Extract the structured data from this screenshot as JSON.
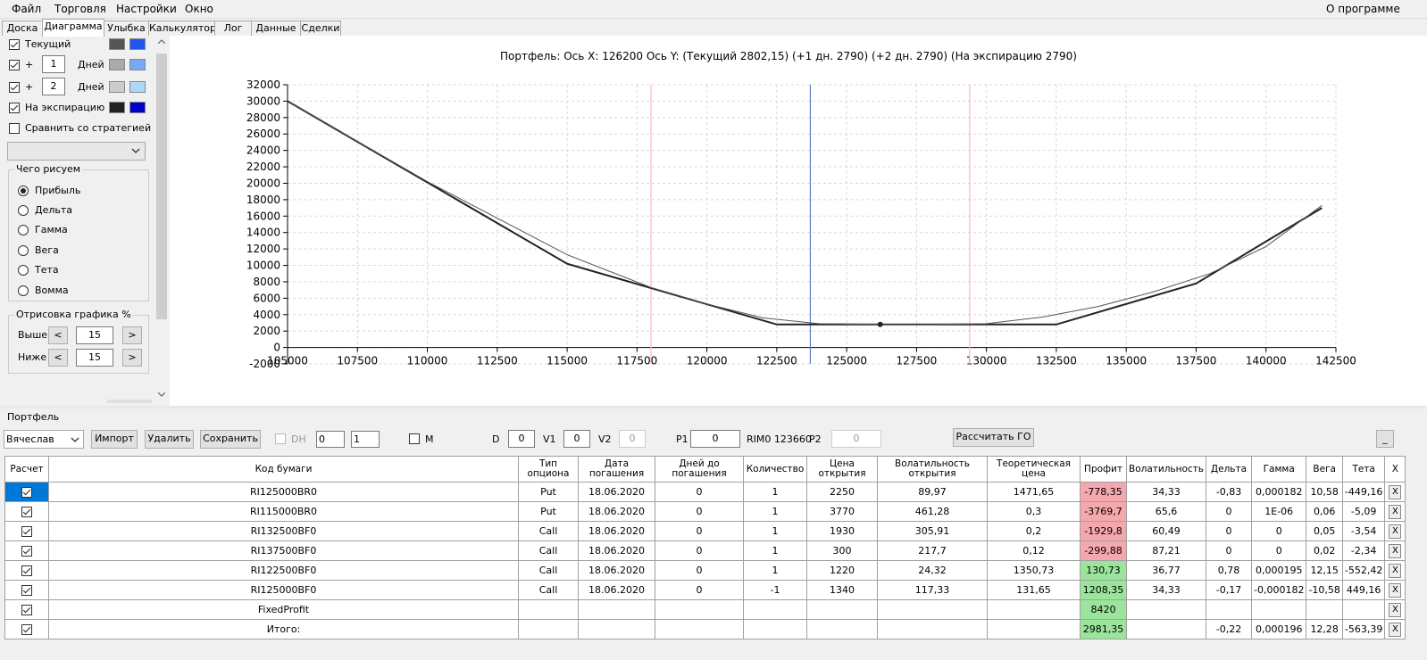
{
  "menu": {
    "file": "Файл",
    "trade": "Торговля",
    "settings": "Настройки",
    "window": "Окно",
    "about": "О программе"
  },
  "tabs": [
    "Доска",
    "Диаграмма",
    "Улыбка",
    "Калькулятор",
    "Лог",
    "Данные",
    "Сделки"
  ],
  "left": {
    "current": "Текущий",
    "plus1": "+",
    "days1": "1",
    "days_label1": "Дней",
    "plus2": "+",
    "days2": "2",
    "days_label2": "Дней",
    "expiration": "На экспирацию",
    "compare": "Сравнить со стратегией",
    "what_group": "Чего рисуем",
    "radios": [
      "Прибыль",
      "Дельта",
      "Гамма",
      "Вега",
      "Тета",
      "Вомма"
    ],
    "draw_group": "Отрисовка графика %",
    "above": "Выше",
    "above_val": "15",
    "below": "Ниже",
    "below_val": "15",
    "lt": "<",
    "gt": ">",
    "colors": {
      "current_dark": "#555555",
      "current_light": "#2255ee",
      "d1_dark": "#aaaaaa",
      "d1_light": "#77aaf5",
      "d2_dark": "#cccccc",
      "d2_light": "#aad8f5",
      "exp_dark": "#222222",
      "exp_light": "#0000cc"
    }
  },
  "chart_data": {
    "type": "line",
    "title": "Портфель: Ось X:  126200 Ось Y:  (Текущий 2802,15)  (+1 дн. 2790)  (+2 дн. 2790)  (На экспирацию 2790)",
    "xlim": [
      105000,
      142500
    ],
    "ylim": [
      -2000,
      32000
    ],
    "x_ticks": [
      "105000",
      "107500",
      "110000",
      "112500",
      "115000",
      "117500",
      "120000",
      "122500",
      "125000",
      "127500",
      "130000",
      "132500",
      "135000",
      "137500",
      "140000",
      "142500"
    ],
    "y_ticks": [
      "32000",
      "30000",
      "28000",
      "26000",
      "24000",
      "22000",
      "20000",
      "18000",
      "16000",
      "14000",
      "12000",
      "10000",
      "8000",
      "6000",
      "4000",
      "2000",
      "0",
      "-2000"
    ],
    "series": [
      {
        "values_x": [
          105000,
          115000,
          122500,
          132500,
          137500,
          142000
        ],
        "values_y": [
          30000,
          10200,
          2800,
          2800,
          7800,
          17000
        ],
        "color": "#222222"
      },
      {
        "values_x": [
          105000,
          110000,
          115000,
          118000,
          120000,
          122000,
          124000,
          126200,
          128000,
          130000,
          132000,
          134000,
          136000,
          138000,
          140000,
          142000
        ],
        "values_y": [
          30000,
          20200,
          11300,
          7300,
          5300,
          3600,
          2900,
          2802,
          2790,
          2900,
          3700,
          5000,
          6800,
          9000,
          12300,
          17300
        ],
        "color": "#555555"
      }
    ],
    "marker": {
      "x": 126200,
      "y": 2802
    },
    "vlines": [
      {
        "x": 118000,
        "color": "#ffb6c1"
      },
      {
        "x": 123700,
        "color": "#5b7fbf"
      },
      {
        "x": 129400,
        "color": "#ffb6c1"
      }
    ]
  },
  "portfolio": {
    "label": "Портфель",
    "account": "Вячеслав",
    "import": "Импорт",
    "delete": "Удалить",
    "save": "Сохранить",
    "dh": "DH",
    "dh_v1": "0",
    "dh_v2": "1",
    "m": "M",
    "d": "D",
    "d_val": "0",
    "v1": "V1",
    "v1_val": "0",
    "v2": "V2",
    "v2_val": "0",
    "p1": "P1",
    "p1_val": "0",
    "rim": "RIM0 123660",
    "p2": "P2",
    "p2_val": "0",
    "calc": "Рассчитать ГО",
    "minimize": "_"
  },
  "table": {
    "headers": [
      "Расчет",
      "Код бумаги",
      "Тип опциона",
      "Дата погашения",
      "Дней до погашения",
      "Количество",
      "Цена открытия",
      "Волатильность открытия",
      "Теоретическая цена",
      "Профит",
      "Волатильность",
      "Дельта",
      "Гамма",
      "Вега",
      "Тета",
      "X"
    ],
    "rows": [
      {
        "code": "RI125000BR0",
        "type": "Put",
        "date": "18.06.2020",
        "days": "0",
        "qty": "1",
        "price": "2250",
        "vol_open": "89,97",
        "theo": "1471,65",
        "profit": "-778,35",
        "vol": "34,33",
        "delta": "-0,83",
        "gamma": "0,000182",
        "vega": "10,58",
        "theta": "-449,16",
        "x": "X",
        "neg": true
      },
      {
        "code": "RI115000BR0",
        "type": "Put",
        "date": "18.06.2020",
        "days": "0",
        "qty": "1",
        "price": "3770",
        "vol_open": "461,28",
        "theo": "0,3",
        "profit": "-3769,7",
        "vol": "65,6",
        "delta": "0",
        "gamma": "1E-06",
        "vega": "0,06",
        "theta": "-5,09",
        "x": "X",
        "neg": true
      },
      {
        "code": "RI132500BF0",
        "type": "Call",
        "date": "18.06.2020",
        "days": "0",
        "qty": "1",
        "price": "1930",
        "vol_open": "305,91",
        "theo": "0,2",
        "profit": "-1929,8",
        "vol": "60,49",
        "delta": "0",
        "gamma": "0",
        "vega": "0,05",
        "theta": "-3,54",
        "x": "X",
        "neg": true
      },
      {
        "code": "RI137500BF0",
        "type": "Call",
        "date": "18.06.2020",
        "days": "0",
        "qty": "1",
        "price": "300",
        "vol_open": "217,7",
        "theo": "0,12",
        "profit": "-299,88",
        "vol": "87,21",
        "delta": "0",
        "gamma": "0",
        "vega": "0,02",
        "theta": "-2,34",
        "x": "X",
        "neg": true
      },
      {
        "code": "RI122500BF0",
        "type": "Call",
        "date": "18.06.2020",
        "days": "0",
        "qty": "1",
        "price": "1220",
        "vol_open": "24,32",
        "theo": "1350,73",
        "profit": "130,73",
        "vol": "36,77",
        "delta": "0,78",
        "gamma": "0,000195",
        "vega": "12,15",
        "theta": "-552,42",
        "x": "X",
        "neg": false
      },
      {
        "code": "RI125000BF0",
        "type": "Call",
        "date": "18.06.2020",
        "days": "0",
        "qty": "-1",
        "price": "1340",
        "vol_open": "117,33",
        "theo": "131,65",
        "profit": "1208,35",
        "vol": "34,33",
        "delta": "-0,17",
        "gamma": "-0,000182",
        "vega": "-10,58",
        "theta": "449,16",
        "x": "X",
        "neg": false
      },
      {
        "code": "FixedProfit",
        "type": "",
        "date": "",
        "days": "",
        "qty": "",
        "price": "",
        "vol_open": "",
        "theo": "",
        "profit": "8420",
        "vol": "",
        "delta": "",
        "gamma": "",
        "vega": "",
        "theta": "",
        "x": "X",
        "neg": false
      },
      {
        "code": "Итого:",
        "type": "",
        "date": "",
        "days": "",
        "qty": "",
        "price": "",
        "vol_open": "",
        "theo": "",
        "profit": "2981,35",
        "vol": "",
        "delta": "-0,22",
        "gamma": "0,000196",
        "vega": "12,28",
        "theta": "-563,39",
        "x": "X",
        "neg": false
      }
    ]
  }
}
